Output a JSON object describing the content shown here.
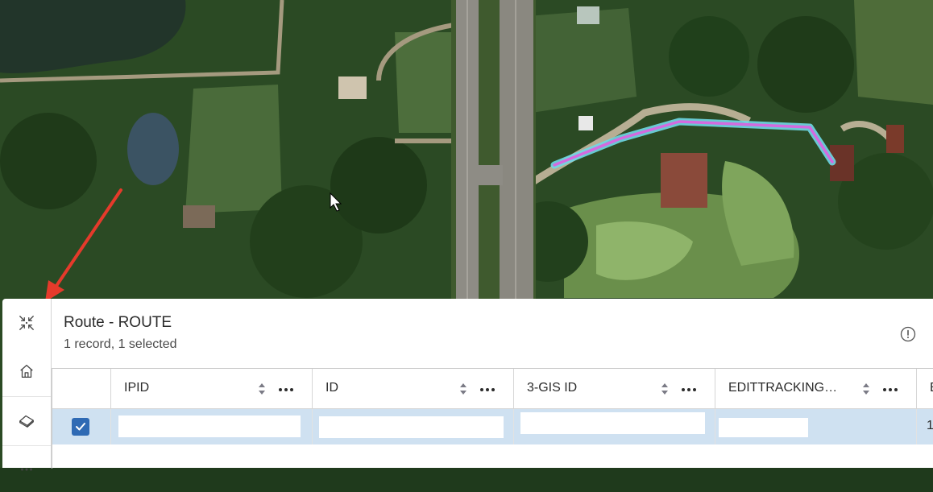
{
  "layer_table": {
    "title": "Route - ROUTE",
    "subtitle": "1 record, 1 selected",
    "columns": [
      {
        "label": "IPID"
      },
      {
        "label": "ID"
      },
      {
        "label": "3-GIS ID"
      },
      {
        "label": "EDITTRACKING…"
      },
      {
        "label": "E"
      }
    ],
    "rows": [
      {
        "selected": true,
        "cells": [
          "",
          "",
          "",
          "",
          "1"
        ]
      }
    ]
  },
  "rail": {
    "icons": [
      "collapse-icon",
      "home-icon",
      "eraser-icon",
      "more-icon"
    ]
  },
  "colors": {
    "selection_row": "#cfe1f1",
    "checkbox": "#2f6ab4",
    "route_line": "#d46adf",
    "route_glow": "#6fd8e6",
    "annotation_arrow": "#e53a2b"
  }
}
